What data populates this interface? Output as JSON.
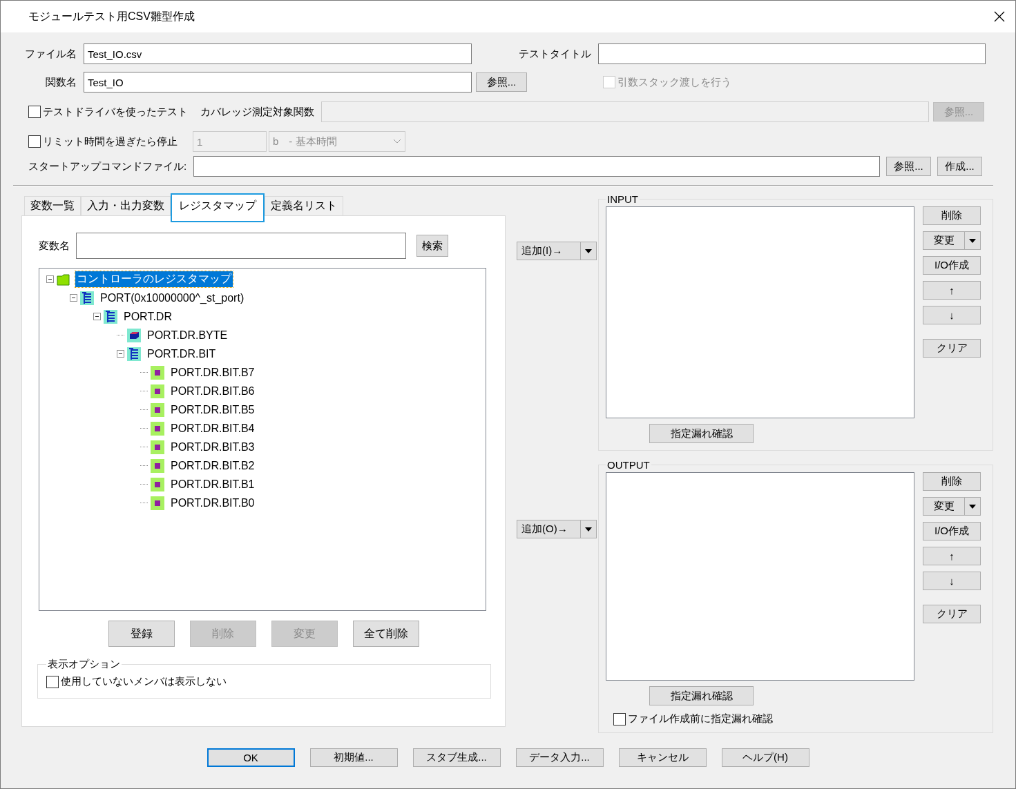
{
  "window": {
    "title": "モジュールテスト用CSV雛型作成"
  },
  "form": {
    "file_name": {
      "label": "ファイル名",
      "value": "Test_IO.csv"
    },
    "test_title": {
      "label": "テストタイトル"
    },
    "function_name": {
      "label": "関数名",
      "value": "Test_IO",
      "button": {
        "label": "参照...",
        "disabled": false
      }
    },
    "stack_passing": {
      "label": "引数スタック渡しを行う",
      "checked": false,
      "disabled": true
    },
    "test_driver": {
      "label": "テストドライバを使ったテスト",
      "checked": false,
      "disabled": false
    },
    "coverage": {
      "label": "カバレッジ測定対象関数",
      "disabled": true,
      "button": {
        "label": "参照...",
        "disabled": true
      }
    },
    "time_limit": {
      "label": "リミット時間を過ぎたら停止",
      "checked": false,
      "disabled": false
    },
    "time_value": {
      "value": "1",
      "disabled": true
    },
    "time_unit": {
      "value": "b　- 基本時間",
      "disabled": true
    },
    "startup": {
      "label": "スタートアップコマンドファイル:",
      "buttons": [
        {
          "label": "参照...",
          "disabled": false
        },
        {
          "label": "作成...",
          "disabled": false
        }
      ]
    }
  },
  "tabs": [
    {
      "label": "変数一覧",
      "selected": false
    },
    {
      "label": "入力・出力変数",
      "selected": false
    },
    {
      "label": "レジスタマップ",
      "selected": true
    },
    {
      "label": "定義名リスト",
      "selected": false
    }
  ],
  "register_map": {
    "search": {
      "label": "変数名",
      "button": "検索"
    },
    "tree": [
      {
        "label": "コントローラのレジスタマップ",
        "kind": "folder",
        "expanded": true,
        "selected": true,
        "children": [
          {
            "label": "PORT(0x10000000^_st_port)",
            "kind": "struct",
            "expanded": true,
            "selected": false,
            "children": [
              {
                "label": "PORT.DR",
                "kind": "struct",
                "expanded": true,
                "selected": false,
                "children": [
                  {
                    "label": "PORT.DR.BYTE",
                    "kind": "variable",
                    "selected": false
                  },
                  {
                    "label": "PORT.DR.BIT",
                    "kind": "struct",
                    "expanded": true,
                    "selected": false,
                    "children": [
                      {
                        "label": "PORT.DR.BIT.B7",
                        "kind": "bit",
                        "selected": false
                      },
                      {
                        "label": "PORT.DR.BIT.B6",
                        "kind": "bit",
                        "selected": false
                      },
                      {
                        "label": "PORT.DR.BIT.B5",
                        "kind": "bit",
                        "selected": false
                      },
                      {
                        "label": "PORT.DR.BIT.B4",
                        "kind": "bit",
                        "selected": false
                      },
                      {
                        "label": "PORT.DR.BIT.B3",
                        "kind": "bit",
                        "selected": false
                      },
                      {
                        "label": "PORT.DR.BIT.B2",
                        "kind": "bit",
                        "selected": false
                      },
                      {
                        "label": "PORT.DR.BIT.B1",
                        "kind": "bit",
                        "selected": false
                      },
                      {
                        "label": "PORT.DR.BIT.B0",
                        "kind": "bit",
                        "selected": false
                      }
                    ]
                  }
                ]
              }
            ]
          }
        ]
      }
    ],
    "buttons": [
      {
        "label": "登録",
        "disabled": false
      },
      {
        "label": "削除",
        "disabled": true
      },
      {
        "label": "変更",
        "disabled": true
      },
      {
        "label": "全て削除",
        "disabled": false
      }
    ],
    "display_options": {
      "title": "表示オプション",
      "checkbox": {
        "label": "使用していないメンバは表示しない",
        "checked": false,
        "disabled": false
      }
    }
  },
  "groups": [
    {
      "title": "INPUT",
      "add_button": "追加(I)→",
      "check_button": "指定漏れ確認",
      "buttons": [
        {
          "label": "削除",
          "kind": "button"
        },
        {
          "label": "変更",
          "kind": "split"
        },
        {
          "label": "I/O作成",
          "kind": "button"
        },
        {
          "label": "↑",
          "kind": "button"
        },
        {
          "label": "↓",
          "kind": "button"
        },
        {
          "label": "クリア",
          "kind": "button"
        }
      ]
    },
    {
      "title": "OUTPUT",
      "add_button": "追加(O)→",
      "check_button": "指定漏れ確認",
      "buttons": [
        {
          "label": "削除",
          "kind": "button"
        },
        {
          "label": "変更",
          "kind": "split"
        },
        {
          "label": "I/O作成",
          "kind": "button"
        },
        {
          "label": "↑",
          "kind": "button"
        },
        {
          "label": "↓",
          "kind": "button"
        },
        {
          "label": "クリア",
          "kind": "button"
        }
      ],
      "checkbox": {
        "label": "ファイル作成前に指定漏れ確認",
        "checked": false,
        "disabled": false
      }
    }
  ],
  "footer_buttons": [
    {
      "label": "OK",
      "default": true
    },
    {
      "label": "初期値...",
      "default": false
    },
    {
      "label": "スタブ生成...",
      "default": false
    },
    {
      "label": "データ入力...",
      "default": false
    },
    {
      "label": "キャンセル",
      "default": false
    },
    {
      "label": "ヘルプ(H)",
      "default": false
    }
  ]
}
